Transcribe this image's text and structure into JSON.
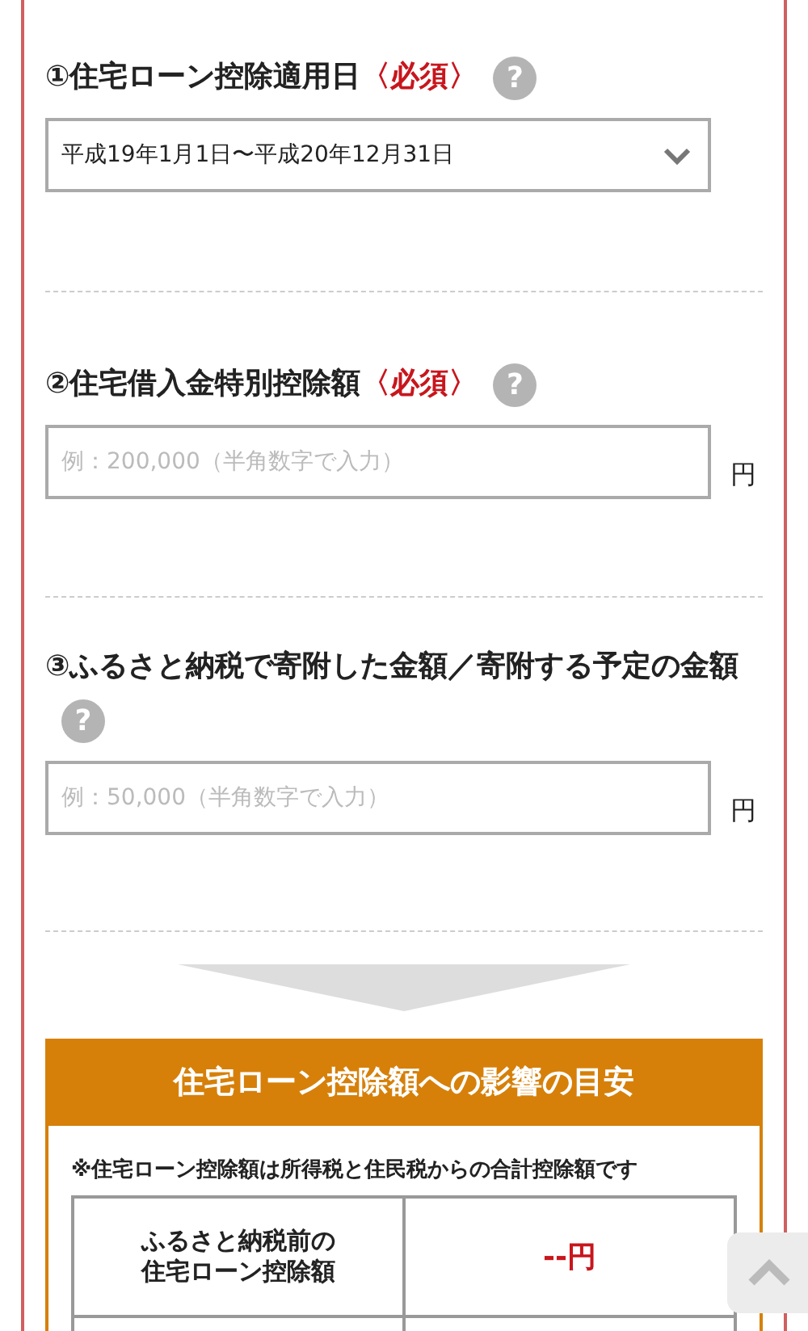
{
  "fields": [
    {
      "kind": "select",
      "label": "①住宅ローン控除適用日",
      "required": "〈必須〉",
      "help": "?",
      "value": "平成19年1月1日〜平成20年12月31日"
    },
    {
      "kind": "input",
      "label": "②住宅借入金特別控除額",
      "required": "〈必須〉",
      "help": "?",
      "placeholder": "例：200,000（半角数字で入力）",
      "unit": "円"
    },
    {
      "kind": "input",
      "label": "③ふるさと納税で寄附した金額／寄附する予定の金額",
      "help": "?",
      "placeholder": "例：50,000（半角数字で入力）",
      "unit": "円"
    }
  ],
  "result": {
    "title": "住宅ローン控除額への影響の目安",
    "note": "※住宅ローン控除額は所得税と住民税からの合計控除額です",
    "rows": [
      {
        "label_lines": [
          "ふるさと納税前の",
          "住宅ローン控除額"
        ],
        "value": "--円"
      }
    ]
  }
}
